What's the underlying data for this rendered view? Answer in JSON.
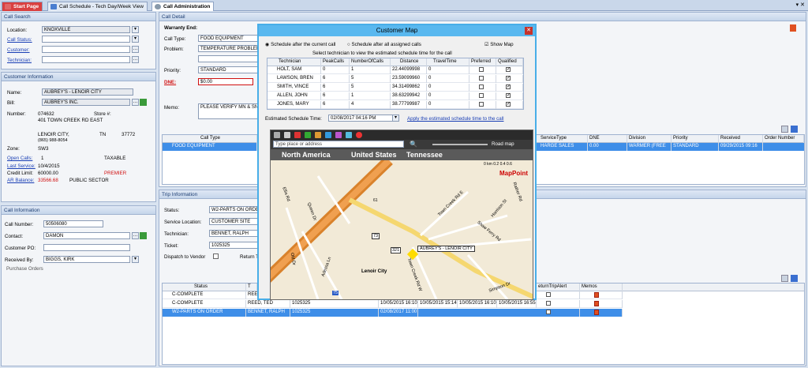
{
  "tabs": [
    "Start Page",
    "Call Schedule - Tech Day/Week View",
    "Call Administration"
  ],
  "call_search": {
    "header": "Call Search",
    "location_label": "Location:",
    "location_value": "KNOXVILLE",
    "call_status_label": "Call Status:",
    "customer_label": "Customer:",
    "technician_label": "Technician:"
  },
  "customer_info": {
    "header": "Customer Information",
    "name_label": "Name:",
    "name_value": "AUBREY'S - LENOIR CITY",
    "bill_label": "Bill:",
    "bill_value": "AUBREY'S INC.",
    "number_label": "Number:",
    "number_value": "074632",
    "store_label": "Store #:",
    "address": "401 TOWN CREEK RD EAST",
    "city": "LENOIR CITY,",
    "state": "TN",
    "zip": "37772",
    "phone": "(865) 988-8054",
    "zone_label": "Zone:",
    "zone_value": "SW3",
    "open_calls_label": "Open Calls:",
    "open_calls_value": "1",
    "taxable": "TAXABLE",
    "last_service_label": "Last Service:",
    "last_service_value": "10/4/2015",
    "credit_limit_label": "Credit Limit:",
    "credit_limit_value": "60000.00",
    "premier": "PREMIER",
    "ar_balance_label": "AR Balance:",
    "ar_balance_value": "33566.68",
    "sector": "PUBLIC SECTOR"
  },
  "call_info": {
    "header": "Call Information",
    "call_number_label": "Call Number:",
    "call_number_value": "50506080",
    "contact_label": "Contact:",
    "contact_value": "DAMON",
    "customer_po_label": "Customer PO:",
    "received_by_label": "Received By:",
    "received_by_value": "BIGGS, KIRK",
    "purchase_orders": "Purchase Orders"
  },
  "call_detail": {
    "header": "Call Detail",
    "warranty_end": "Warranty End:",
    "call_type_label": "Call Type:",
    "call_type_value": "FOOD EQUIPMENT",
    "problem_label": "Problem:",
    "problem_value": "TEMPERATURE PROBLEM",
    "priority_label": "Priority:",
    "priority_value": "STANDARD",
    "dne_label": "DNE:",
    "dne_value": "$0.00",
    "memo_label": "Memo:",
    "memo_value": "PLEASE VERIFY MN & SN -",
    "grid_headers": [
      "Call Type",
      "ServiceType",
      "DNE",
      "Division",
      "Priority",
      "Received",
      "Order Number"
    ],
    "grid_row": [
      "FOOD EQUIPMENT",
      "HARGE SALES",
      "0.00",
      "WARMER (FREE",
      "STANDARD",
      "09/29/2015 09:16",
      ""
    ]
  },
  "trip_info": {
    "header": "Trip Information",
    "status_label": "Status:",
    "status_value": "W2-PARTS ON ORDE",
    "service_location_label": "Service Location:",
    "service_location_value": "CUSTOMER SITE",
    "technician_label": "Technician:",
    "technician_value": "BENNET, RALPH",
    "ticket_label": "Ticket:",
    "ticket_value": "1025325",
    "dispatch_label": "Dispatch to Vendor",
    "return_label": "Return T",
    "grid_headers": [
      "Status",
      "T",
      "",
      "",
      "",
      "",
      "eturnTripAlert",
      "Memos"
    ],
    "rows": [
      [
        "C-COMPLETE",
        "REED, TED",
        "",
        "",
        "",
        ""
      ],
      [
        "C-COMPLETE",
        "REED, TED",
        "1025325",
        "10/05/2015 16:10",
        "10/05/2015 15:14",
        "10/05/2015 16:10",
        "10/05/2015 16:55"
      ],
      [
        "W2-PARTS ON ORDER",
        "BENNET, RALPH",
        "1025325",
        "02/08/2017 11:00",
        "",
        "",
        ""
      ]
    ]
  },
  "customer_map": {
    "title": "Customer Map",
    "opt1": "Schedule after the current call",
    "opt2": "Schedule after all assigned calls",
    "show_map": "Show Map",
    "instructions": "Select technician to view the estimated schedule time for the call",
    "headers": [
      "Technician",
      "PeakCalls",
      "NumberOfCalls",
      "Distance",
      "TravelTime",
      "Preferred",
      "Qualified"
    ],
    "rows": [
      [
        "HOLT, SAM",
        "0",
        "1",
        "22.44099998",
        "0"
      ],
      [
        "LAWSON, BREN",
        "6",
        "5",
        "23.59099960",
        "0"
      ],
      [
        "SMITH, VINCE",
        "6",
        "5",
        "34.31499862",
        "0"
      ],
      [
        "ALLEN, JOHN",
        "6",
        "1",
        "38.63299942",
        "0"
      ],
      [
        "JONES, MARY",
        "6",
        "4",
        "38.77799987",
        "0"
      ]
    ],
    "est_label": "Estimated Schedule Time:",
    "est_value": "02/08/2017 04:16 PM",
    "apply_link": "Apply the estimated schedule time to the call",
    "search_placeholder": "Type place or address",
    "road_map": "Road map",
    "breadcrumb": [
      "North America",
      "United States",
      "Tennessee"
    ],
    "scale": "0 km 0.2   0.4   0.6",
    "brand": "MapPoint",
    "map_labels": [
      "Lenoir City",
      "AUBREY'S - LENOIR CITY",
      "Town Creek Rd E",
      "Shaw Ferry Rd",
      "Harrison St",
      "Simpson Dr",
      "Town Creek Rd W",
      "Ellis Rd",
      "Queen Dr",
      "Adessa Ln",
      "Old Dr",
      "Rather Rd",
      "321",
      "73",
      "75",
      "61"
    ]
  }
}
